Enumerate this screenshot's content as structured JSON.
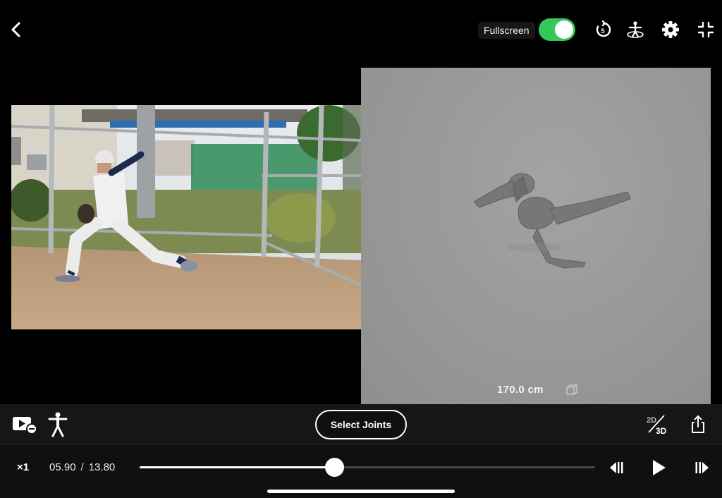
{
  "topbar": {
    "fullscreen_label": "Fullscreen",
    "fullscreen_on": true,
    "toggle_color": "#34c759",
    "icons": [
      "back-chevron-icon",
      "replay-icon",
      "pose-rotate-icon",
      "gear-icon",
      "exit-fullscreen-icon"
    ]
  },
  "model": {
    "height_value": "170.0 cm",
    "background": "#999999"
  },
  "toolbar": {
    "select_joints_label": "Select Joints",
    "mode_2d": "2D",
    "mode_3d": "3D",
    "icons": [
      "video-minus-icon",
      "body-figure-icon",
      "mode-2d3d-icon",
      "share-icon"
    ]
  },
  "playback": {
    "speed": "×1",
    "current_time": "05.90",
    "total_time": "13.80",
    "separator": "/",
    "progress": 0.4275,
    "icons": [
      "step-back-icon",
      "play-icon",
      "step-forward-icon"
    ]
  }
}
